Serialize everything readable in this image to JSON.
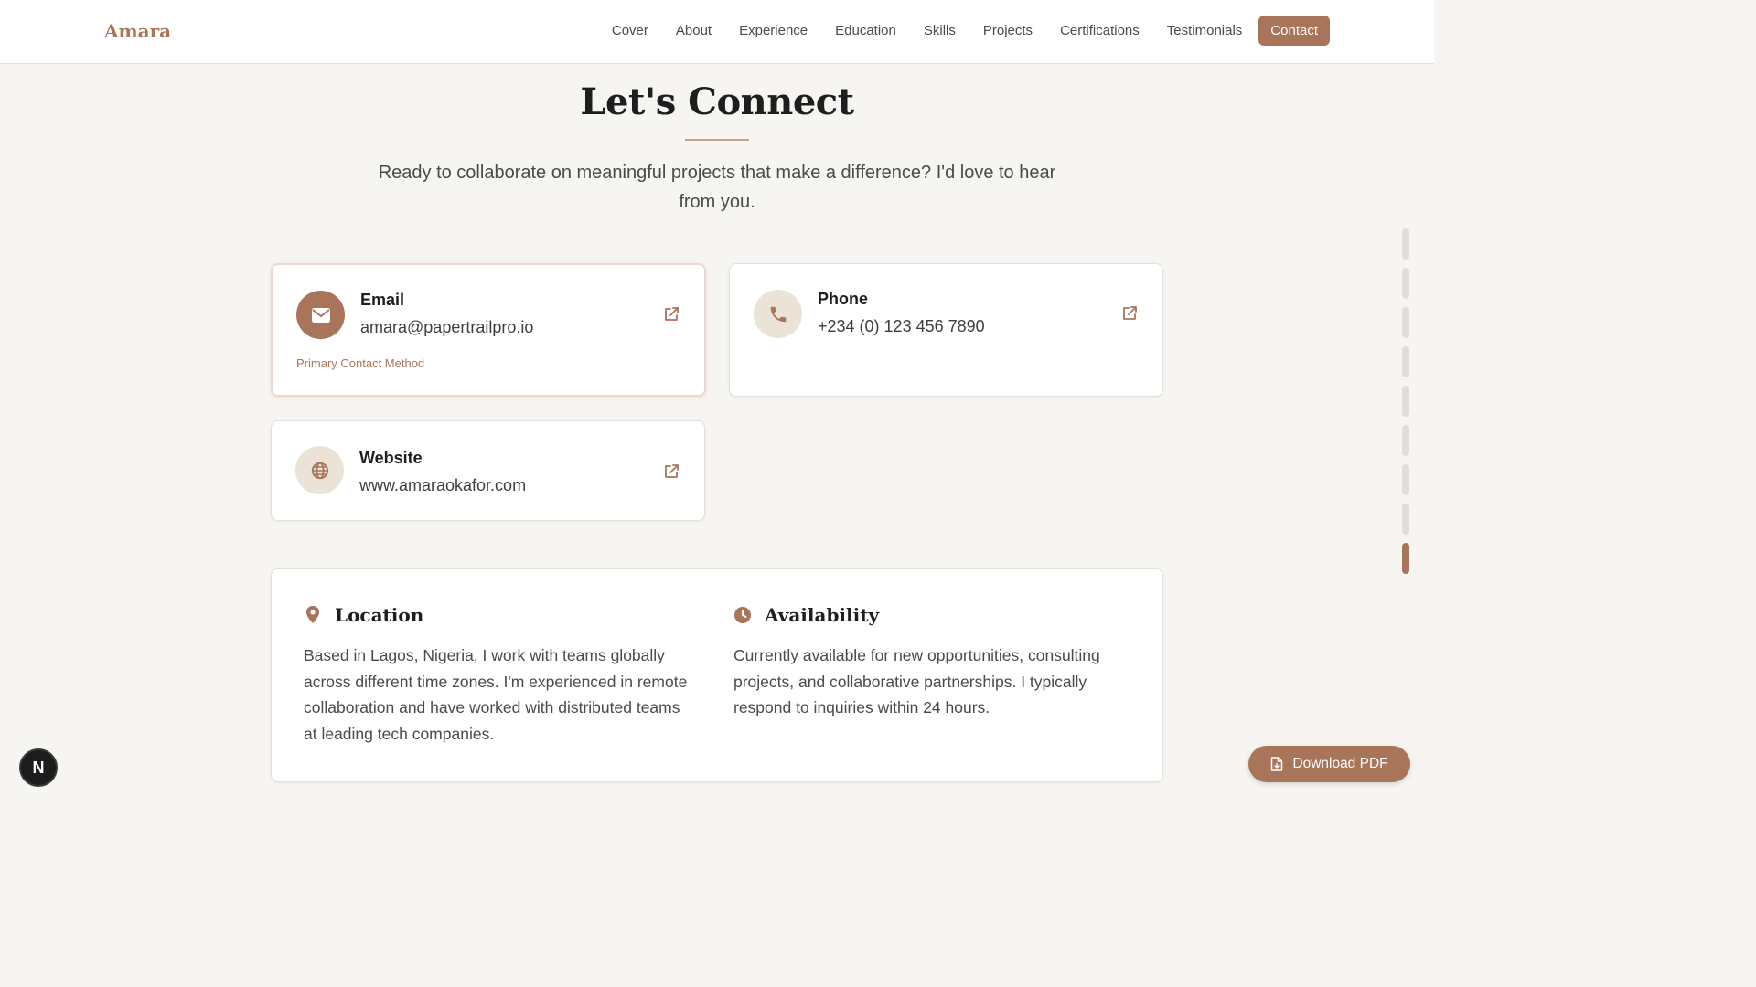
{
  "brand": "Amara",
  "nav": {
    "items": [
      "Cover",
      "About",
      "Experience",
      "Education",
      "Skills",
      "Projects",
      "Certifications",
      "Testimonials"
    ],
    "active": "Contact"
  },
  "section": {
    "title": "Let's Connect",
    "intro": "Ready to collaborate on meaningful projects that make a difference? I'd love to hear from you."
  },
  "contacts": {
    "email": {
      "label": "Email",
      "value": "amara@papertrailpro.io",
      "note": "Primary Contact Method",
      "icon": "mail-icon"
    },
    "phone": {
      "label": "Phone",
      "value": "+234 (0) 123 456 7890",
      "icon": "phone-icon"
    },
    "website": {
      "label": "Website",
      "value": "www.amaraokafor.com",
      "icon": "globe-icon"
    }
  },
  "location": {
    "title": "Location",
    "text": "Based in Lagos, Nigeria, I work with teams globally across different time zones. I'm experienced in remote collaboration and have worked with distributed teams at leading tech companies.",
    "icon": "map-pin-icon"
  },
  "availability": {
    "title": "Availability",
    "text": "Currently available for new opportunities, consulting projects, and collaborative partnerships. I typically respond to inquiries within 24 hours.",
    "icon": "clock-icon"
  },
  "scroll_nav": {
    "count": 9,
    "active_index": 8
  },
  "badge": "N",
  "download": {
    "label": "Download PDF",
    "icon": "file-icon"
  },
  "colors": {
    "accent": "#a8745a",
    "soft": "#ebe3d7",
    "background": "#f7f5f2"
  }
}
